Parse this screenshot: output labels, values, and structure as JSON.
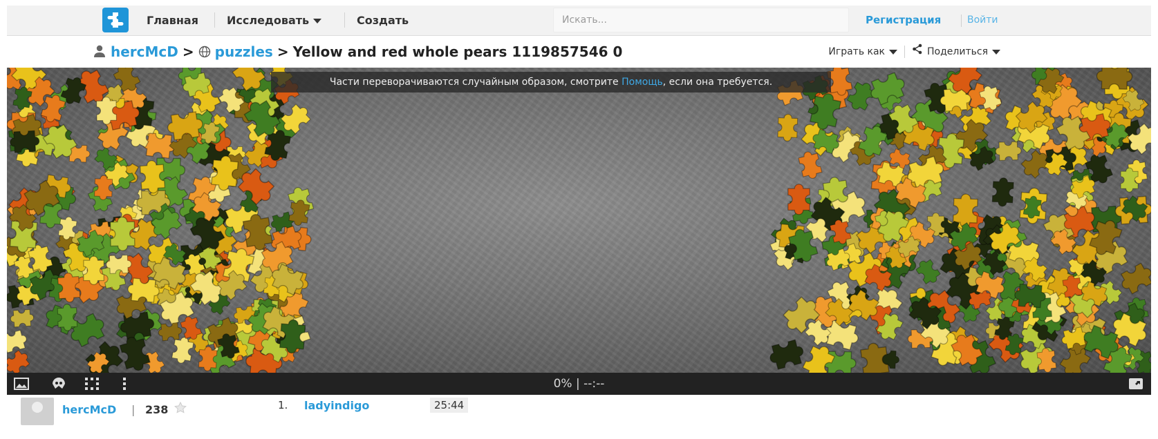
{
  "nav": {
    "home": "Главная",
    "explore": "Исследовать",
    "create": "Создать",
    "search_placeholder": "Искать...",
    "signup": "Регистрация",
    "login": "Войти",
    "logo_icon": "puzzle-logo-icon"
  },
  "breadcrumb": {
    "user": "hercMcD",
    "separator": ">",
    "category": "puzzles",
    "title": "Yellow and red whole pears 1119857546 0"
  },
  "actions": {
    "play_as": "Играть как",
    "share": "Поделиться"
  },
  "notice": {
    "before": "Части переворачиваются случайным образом, смотрите ",
    "link": "Помощь",
    "after": ", если она требуется."
  },
  "controls": {
    "progress": "0% | --:--",
    "icons": [
      "image-preview-icon",
      "ghost-icon",
      "grid-icon",
      "more-icon",
      "fullscreen-icon"
    ]
  },
  "player": {
    "name": "hercMcD",
    "separator": "|",
    "score": "238"
  },
  "leaderboard": [
    {
      "rank": "1.",
      "user": "ladyindigo",
      "time": "25:44"
    }
  ],
  "colors": {
    "accent": "#2a9ad8",
    "logo": "#1f95d8",
    "board": "#6e6e6e",
    "control_bar": "#222222"
  }
}
